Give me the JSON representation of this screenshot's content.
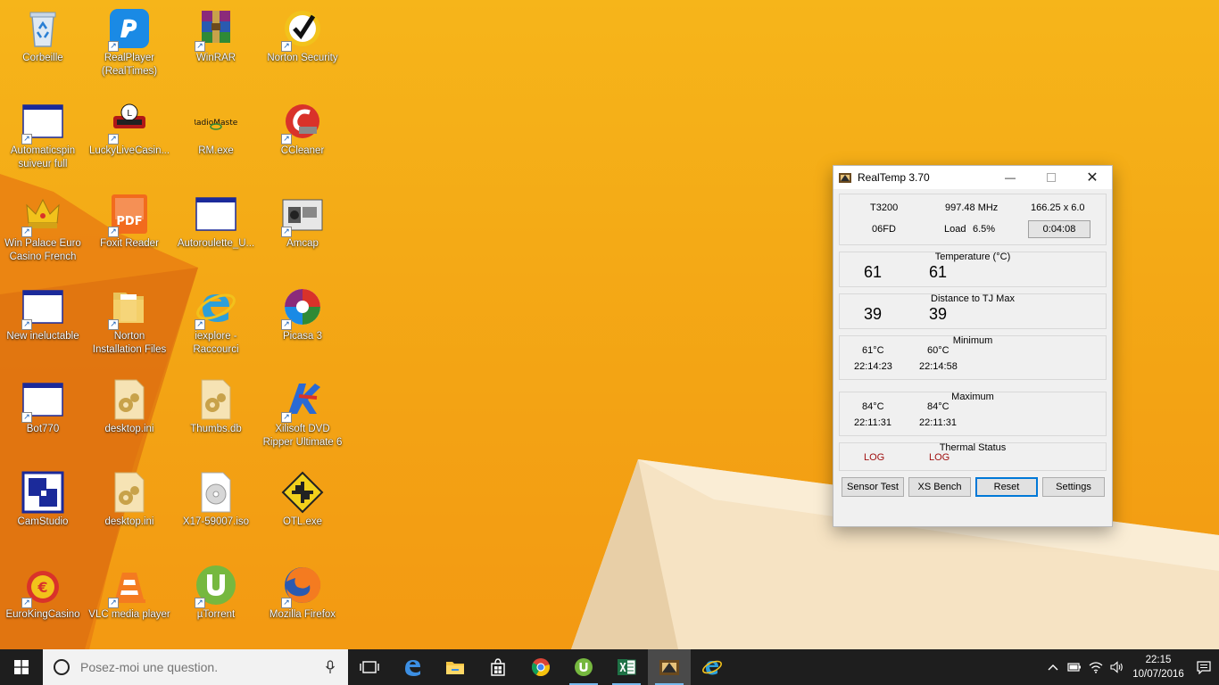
{
  "desktop": {
    "icons": [
      {
        "label": "Corbeille",
        "shortcut": false,
        "icon": "recycle-bin-icon"
      },
      {
        "label": "RealPlayer\n(RealTimes)",
        "shortcut": true,
        "icon": "realplayer-icon"
      },
      {
        "label": "WinRAR",
        "shortcut": true,
        "icon": "winrar-icon"
      },
      {
        "label": "Norton Security",
        "shortcut": true,
        "icon": "norton-icon"
      },
      {
        "label": "Automaticspin\nsuiveur full",
        "shortcut": true,
        "icon": "app-window-icon"
      },
      {
        "label": "LuckyLiveCasin...",
        "shortcut": true,
        "icon": "casino-icon"
      },
      {
        "label": "RM.exe",
        "shortcut": false,
        "icon": "radiomaster-icon"
      },
      {
        "label": "CCleaner",
        "shortcut": true,
        "icon": "ccleaner-icon"
      },
      {
        "label": "Win Palace Euro\nCasino French",
        "shortcut": true,
        "icon": "crown-icon"
      },
      {
        "label": "Foxit Reader",
        "shortcut": true,
        "icon": "pdf-icon"
      },
      {
        "label": "Autoroulette_U...",
        "shortcut": false,
        "icon": "app-window-icon"
      },
      {
        "label": "Amcap",
        "shortcut": true,
        "icon": "camera-icon"
      },
      {
        "label": "New ineluctable",
        "shortcut": true,
        "icon": "app-window-icon"
      },
      {
        "label": "Norton\nInstallation Files",
        "shortcut": true,
        "icon": "folder-icon"
      },
      {
        "label": "iexplore -\nRaccourci",
        "shortcut": true,
        "icon": "internet-explorer-icon"
      },
      {
        "label": "Picasa 3",
        "shortcut": true,
        "icon": "picasa-icon"
      },
      {
        "label": "Bot770",
        "shortcut": true,
        "icon": "app-window-icon"
      },
      {
        "label": "desktop.ini",
        "shortcut": false,
        "icon": "settings-file-icon"
      },
      {
        "label": "Thumbs.db",
        "shortcut": false,
        "icon": "settings-file-icon"
      },
      {
        "label": "Xilisoft DVD\nRipper Ultimate 6",
        "shortcut": true,
        "icon": "xilisoft-icon"
      },
      {
        "label": "CamStudio",
        "shortcut": false,
        "icon": "camstudio-icon"
      },
      {
        "label": "desktop.ini",
        "shortcut": false,
        "icon": "settings-file-icon"
      },
      {
        "label": "X17-59007.iso",
        "shortcut": false,
        "icon": "disc-file-icon"
      },
      {
        "label": "OTL.exe",
        "shortcut": false,
        "icon": "otl-icon"
      },
      {
        "label": "EuroKingCasino",
        "shortcut": true,
        "icon": "euroking-icon"
      },
      {
        "label": "VLC media player",
        "shortcut": true,
        "icon": "vlc-icon"
      },
      {
        "label": "µTorrent",
        "shortcut": true,
        "icon": "utorrent-icon"
      },
      {
        "label": "Mozilla Firefox",
        "shortcut": true,
        "icon": "firefox-icon"
      }
    ]
  },
  "realtemp": {
    "title": "RealTemp 3.70",
    "cpu": {
      "model": "T3200",
      "frequency": "997.48 MHz",
      "multiplier": "166.25 x 6.0",
      "cpuid": "06FD",
      "load_label": "Load",
      "load_value": "6.5%",
      "timer": "0:04:08"
    },
    "temperature": {
      "title": "Temperature (°C)",
      "core0": "61",
      "core1": "61"
    },
    "distance": {
      "title": "Distance to TJ Max",
      "core0": "39",
      "core1": "39"
    },
    "minimum": {
      "title": "Minimum",
      "core0_temp": "61°C",
      "core1_temp": "60°C",
      "core0_time": "22:14:23",
      "core1_time": "22:14:58"
    },
    "maximum": {
      "title": "Maximum",
      "core0_temp": "84°C",
      "core1_temp": "84°C",
      "core0_time": "22:11:31",
      "core1_time": "22:11:31"
    },
    "thermal": {
      "title": "Thermal Status",
      "core0": "LOG",
      "core1": "LOG"
    },
    "buttons": {
      "sensor_test": "Sensor Test",
      "xs_bench": "XS Bench",
      "reset": "Reset",
      "settings": "Settings"
    }
  },
  "taskbar": {
    "search_placeholder": "Posez-moi une question.",
    "clock_time": "22:15",
    "clock_date": "10/07/2016"
  },
  "colors": {
    "accent": "#0078d7",
    "taskbar": "#1e1e1e",
    "status_red": "#a01010"
  }
}
